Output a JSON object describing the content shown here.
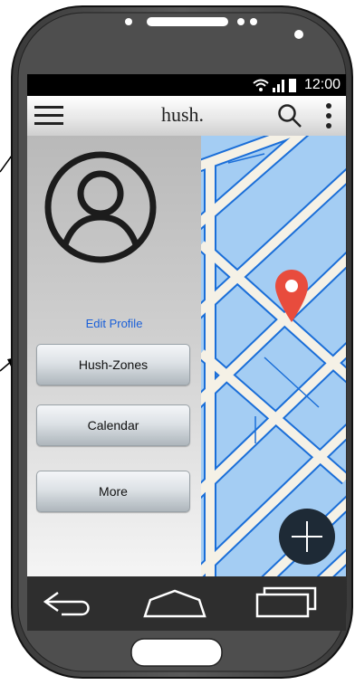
{
  "status_bar": {
    "time": "12:00"
  },
  "app_bar": {
    "title": "hush."
  },
  "drawer": {
    "edit_profile_label": "Edit Profile",
    "items": [
      {
        "label": "Hush-Zones"
      },
      {
        "label": "Calendar"
      },
      {
        "label": "More"
      }
    ]
  },
  "colors": {
    "map_water": "#a4cdf3",
    "map_roads": "#f5f1e6",
    "pin": "#e84c3d",
    "link": "#1a5fd8",
    "fab": "#1e2a36"
  },
  "icons": [
    "menu-icon",
    "search-icon",
    "more-vert-icon",
    "avatar-icon",
    "map-pin-icon",
    "add-icon",
    "back-icon",
    "home-icon",
    "recent-apps-icon",
    "wifi-icon",
    "signal-icon",
    "battery-icon"
  ]
}
